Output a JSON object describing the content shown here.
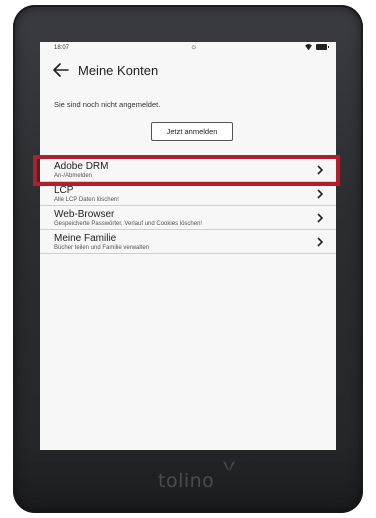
{
  "device": {
    "brand": "tolino"
  },
  "status": {
    "time": "18:07"
  },
  "header": {
    "title": "Meine Konten"
  },
  "notice": {
    "text": "Sie sind noch nicht angemeldet."
  },
  "login_button": {
    "label": "Jetzt anmelden"
  },
  "accounts": [
    {
      "title": "Adobe DRM",
      "subtitle": "An-/Abmelden"
    },
    {
      "title": "LCP",
      "subtitle": "Alle LCP Daten löschen!"
    },
    {
      "title": "Web-Browser",
      "subtitle": "Gespeicherte Passwörter, Verlauf und Cookies löschen!"
    },
    {
      "title": "Meine Familie",
      "subtitle": "Bücher teilen und Familie verwalten"
    }
  ],
  "colors": {
    "highlight": "#b01f2b",
    "bezel": "#2b2d31",
    "screen": "#f7f7f7"
  }
}
